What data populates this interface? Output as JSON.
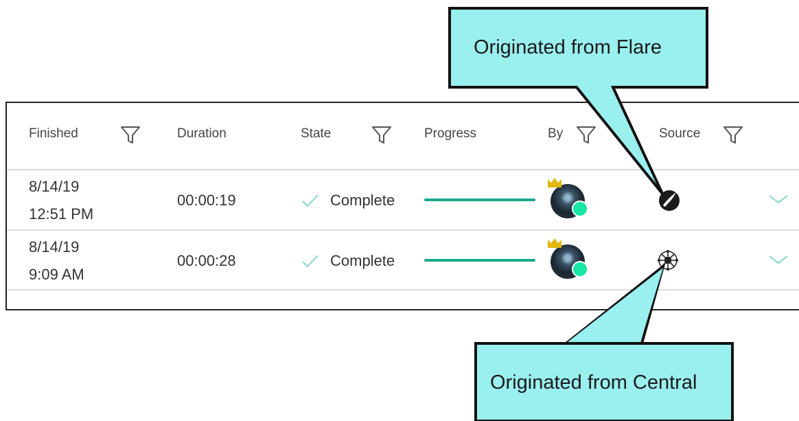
{
  "table": {
    "headers": {
      "finished": "Finished",
      "duration": "Duration",
      "state": "State",
      "progress": "Progress",
      "by": "By",
      "source": "Source"
    },
    "rows": [
      {
        "finished_date": "8/14/19",
        "finished_time": "12:51 PM",
        "duration": "00:00:19",
        "state": "Complete",
        "progress": 1.0,
        "source_icon": "flare-icon"
      },
      {
        "finished_date": "8/14/19",
        "finished_time": "9:09 AM",
        "duration": "00:00:28",
        "state": "Complete",
        "progress": 1.0,
        "source_icon": "central-icon"
      }
    ]
  },
  "callouts": {
    "flare": "Originated from Flare",
    "central": "Originated from Central"
  },
  "colors": {
    "callout_fill": "#9aefef",
    "progress": "#1aaa8a",
    "check": "#7fd9c9",
    "status_online": "#17e6a5",
    "crown": "#e2b711"
  }
}
